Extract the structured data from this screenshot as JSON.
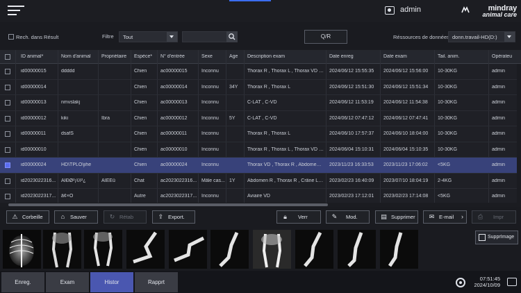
{
  "header": {
    "user": "admin",
    "logo_top": "mindray",
    "logo_bottom": "animal care"
  },
  "filter": {
    "search_in_results_label": "Rech. dans Résult",
    "filter_label": "Filtre",
    "filter_value": "Tout",
    "search_value": "",
    "qr_label": "Q/R",
    "resources_label": "Réssources de données",
    "resources_value": "donn.travail-HD(D:)"
  },
  "table": {
    "columns": [
      "ID animal*",
      "Nom d'animal",
      "Propriétaire",
      "Espèce*",
      "N° d'entrée",
      "Sexe",
      "Age",
      "Description exam",
      "Date enreg",
      "Date exam",
      "Tail. anim.",
      "Opérateu"
    ],
    "rows": [
      [
        "id00000015",
        "ddddd",
        "",
        "Chien",
        "ac00000015",
        "Inconnu",
        "",
        "Thorax R , Thorax L , Thorax VD , T...",
        "2024/06/12 15:55:35",
        "2024/06/12 15:56:00",
        "10-30KG",
        "admin"
      ],
      [
        "id00000014",
        "",
        "",
        "Chien",
        "ac00000014",
        "Inconnu",
        "34Y",
        "Thorax R , Thorax L",
        "2024/06/12 15:51:30",
        "2024/06/12 15:51:34",
        "10-30KG",
        "admin"
      ],
      [
        "id00000013",
        "nmvslakj",
        "",
        "Chien",
        "ac00000013",
        "Inconnu",
        "",
        "C-LAT , C-VD",
        "2024/06/12 11:53:19",
        "2024/06/12 11:54:38",
        "10-30KG",
        "admin"
      ],
      [
        "id00000012",
        "kiki",
        "Ibra",
        "Chien",
        "ac00000012",
        "Inconnu",
        "5Y",
        "C-LAT , C-VD",
        "2024/06/12 07:47:12",
        "2024/06/12 07:47:41",
        "10-30KG",
        "admin"
      ],
      [
        "id00000011",
        "dsafS",
        "",
        "Chien",
        "ac00000011",
        "Inconnu",
        "",
        "Thorax R , Thorax L",
        "2024/06/10 17:57:37",
        "2024/06/10 18:04:00",
        "10-30KG",
        "admin"
      ],
      [
        "id00000010",
        "",
        "",
        "Chien",
        "ac00000010",
        "Inconnu",
        "",
        "Thorax R , Thorax L , Thorax VD , T...",
        "2024/06/04 15:10:31",
        "2024/06/04 15:10:35",
        "10-30KG",
        "admin"
      ],
      [
        "id00000024",
        "HD\\TPLO\\jihe",
        "",
        "Chien",
        "ac00000024",
        "Inconnu",
        "",
        "Thorax VD , Thorax R , Abdomen V...",
        "2023/11/23 16:33:53",
        "2023/11/23 17:06:02",
        "<5KG",
        "admin"
      ],
      [
        "id2023022316...",
        "ÄÏÐØ²¡©Ì²¿",
        "ÄÏÊÈü",
        "Chat",
        "ac2023022316...",
        "Mâle cas...",
        "1Y",
        "Abdomen R , Thorax R , Crâne LAT...",
        "2023/02/23 16:40:09",
        "2023/07/10 18:04:19",
        "2-4KG",
        "admin"
      ],
      [
        "id2023022317...",
        "ã¢×Ö",
        "",
        "Autre",
        "ac2023022317...",
        "Inconnu",
        "",
        "Aviaire VD",
        "2023/02/23 17:12:01",
        "2023/02/23 17:14:08",
        "<5KG",
        "admin"
      ]
    ],
    "selected_row": 6
  },
  "actions": {
    "corbeille": "Corbeille",
    "sauver": "Sauver",
    "retab": "Rétab",
    "export": "Export.",
    "verr": "Verr",
    "mod": "Mod.",
    "supprimer": "Supprimer",
    "email": "E-mail",
    "impr": "Impr"
  },
  "supprimage": "SupprImage",
  "nav": {
    "tabs": [
      "Enreg.",
      "Exam",
      "Histor",
      "Rapprt"
    ],
    "active": "Histor"
  },
  "status": {
    "time": "07:51:45",
    "date": "2024/10/09"
  }
}
